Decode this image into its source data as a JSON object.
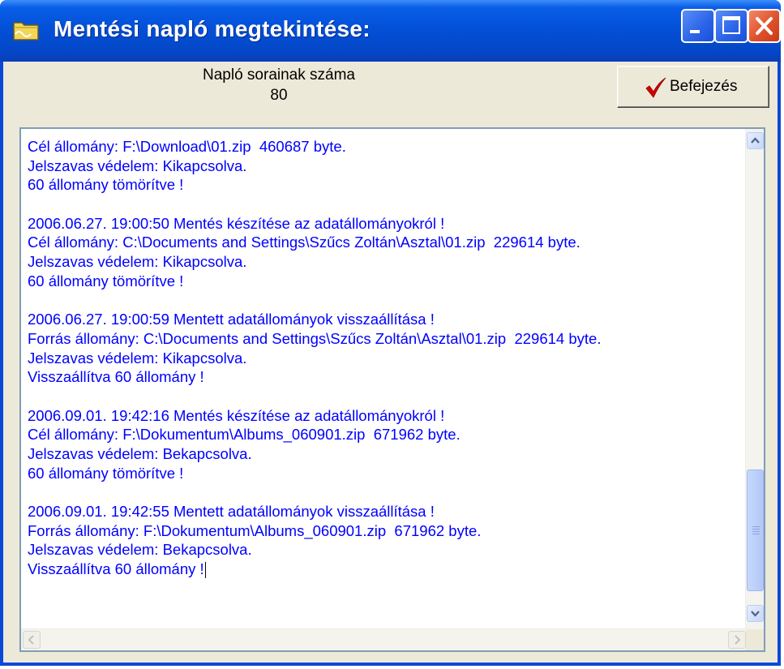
{
  "window": {
    "title": "Mentési napló megtekintése:",
    "icon": "folder-icon"
  },
  "titlebar_buttons": {
    "minimize_icon": "minimize-icon",
    "maximize_icon": "maximize-icon",
    "close_icon": "close-icon"
  },
  "header": {
    "count_label": "Napló sorainak száma",
    "count_value": "80"
  },
  "finish_button": {
    "label": "Befejezés",
    "icon": "checkmark-icon"
  },
  "log": {
    "lines": [
      "Cél állomány: F:\\Download\\01.zip  460687 byte.",
      "Jelszavas védelem: Kikapcsolva.",
      "60 állomány tömörítve !",
      "",
      "2006.06.27. 19:00:50 Mentés készítése az adatállományokról !",
      "Cél állomány: C:\\Documents and Settings\\Szűcs Zoltán\\Asztal\\01.zip  229614 byte.",
      "Jelszavas védelem: Kikapcsolva.",
      "60 állomány tömörítve !",
      "",
      "2006.06.27. 19:00:59 Mentett adatállományok visszaállítása !",
      "Forrás állomány: C:\\Documents and Settings\\Szűcs Zoltán\\Asztal\\01.zip  229614 byte.",
      "Jelszavas védelem: Kikapcsolva.",
      "Visszaállítva 60 állomány !",
      "",
      "2006.09.01. 19:42:16 Mentés készítése az adatállományokról !",
      "Cél állomány: F:\\Dokumentum\\Albums_060901.zip  671962 byte.",
      "Jelszavas védelem: Bekapcsolva.",
      "60 állomány tömörítve !",
      "",
      "2006.09.01. 19:42:55 Mentett adatállományok visszaállítása !",
      "Forrás állomány: F:\\Dokumentum\\Albums_060901.zip  671962 byte.",
      "Jelszavas védelem: Bekapcsolva.",
      "Visszaállítva 60 állomány !"
    ]
  },
  "colors": {
    "log_text": "#0000ff",
    "titlebar": "#0350d8",
    "dialog_bg": "#ece9d8",
    "checkmark": "#d40000"
  }
}
